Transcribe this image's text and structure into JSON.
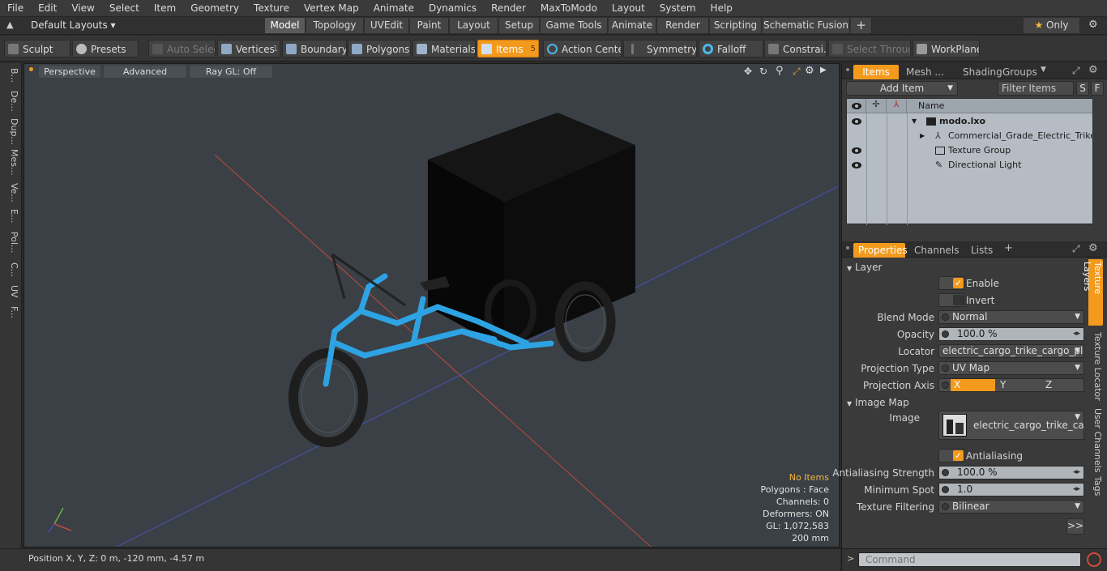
{
  "menu": [
    "File",
    "Edit",
    "View",
    "Select",
    "Item",
    "Geometry",
    "Texture",
    "Vertex Map",
    "Animate",
    "Dynamics",
    "Render",
    "MaxToModo",
    "Layout",
    "System",
    "Help"
  ],
  "layout_selector": "Default Layouts",
  "mode_tabs": [
    "Model",
    "Topology",
    "UVEdit",
    "Paint",
    "Layout",
    "Setup",
    "Game Tools",
    "Animate",
    "Render",
    "Scripting",
    "Schematic Fusion"
  ],
  "only_label": "Only",
  "toolbar": {
    "sculpt": "Sculpt",
    "presets": "Presets",
    "auto_select": "Auto Select",
    "vertices": "Vertices",
    "vertices_count": "1",
    "boundary": "Boundary",
    "polygons": "Polygons",
    "materials": "Materials",
    "items": "Items",
    "items_count": "5",
    "action_center": "Action Center",
    "symmetry": "Symmetry",
    "falloff": "Falloff",
    "constraints": "Constrai…",
    "select_through": "Select Through",
    "workplane": "WorkPlane"
  },
  "left_strip": [
    "B...",
    "De...",
    "Dup...",
    "Mes...",
    "Ve...",
    "E...",
    "Pol...",
    "C...",
    "UV",
    "F..."
  ],
  "viewport": {
    "view": "Perspective",
    "shading": "Advanced",
    "raygl": "Ray GL: Off",
    "stats": {
      "no_items": "No Items",
      "polygons": "Polygons : Face",
      "channels": "Channels: 0",
      "deformers": "Deformers: ON",
      "gl": "GL: 1,072,583",
      "scale": "200 mm"
    }
  },
  "status": "Position X, Y, Z:   0 m, -120 mm, -4.57 m",
  "items_panel": {
    "tabs": [
      "Items",
      "Mesh ...",
      "Shading",
      "Groups"
    ],
    "add_item": "Add Item",
    "filter": "Filter Items",
    "s_btn": "S",
    "f_btn": "F",
    "col_name": "Name",
    "rows": [
      {
        "name": "modo.lxo"
      },
      {
        "name": "Commercial_Grade_Electric_Trike_..."
      },
      {
        "name": "Texture Group"
      },
      {
        "name": "Directional Light"
      }
    ]
  },
  "props_panel": {
    "tabs": [
      "Properties",
      "Channels",
      "Lists"
    ],
    "layer_section": "Layer",
    "enable": "Enable",
    "invert": "Invert",
    "blend_mode_label": "Blend Mode",
    "blend_mode": "Normal",
    "opacity_label": "Opacity",
    "opacity": "100.0 %",
    "locator_label": "Locator",
    "locator": "electric_cargo_trike_cargo_plat...",
    "projection_type_label": "Projection Type",
    "projection_type": "UV Map",
    "projection_axis_label": "Projection Axis",
    "axis_x": "X",
    "axis_y": "Y",
    "axis_z": "Z",
    "image_map_section": "Image Map",
    "image_label": "Image",
    "image": "electric_cargo_trike_ca...",
    "antialiasing": "Antialiasing",
    "aa_strength_label": "Antialiasing Strength",
    "aa_strength": "100.0 %",
    "min_spot_label": "Minimum Spot",
    "min_spot": "1.0",
    "tex_filter_label": "Texture Filtering",
    "tex_filter": "Bilinear",
    "more": ">>",
    "side_tabs": [
      "Texture Layers",
      "Texture Locator",
      "User Channels",
      "Tags"
    ]
  },
  "command_placeholder": "Command",
  "colors": {
    "accent": "#f39a1d",
    "frame": "#2ea3e3",
    "box": "#0b0b0b"
  }
}
